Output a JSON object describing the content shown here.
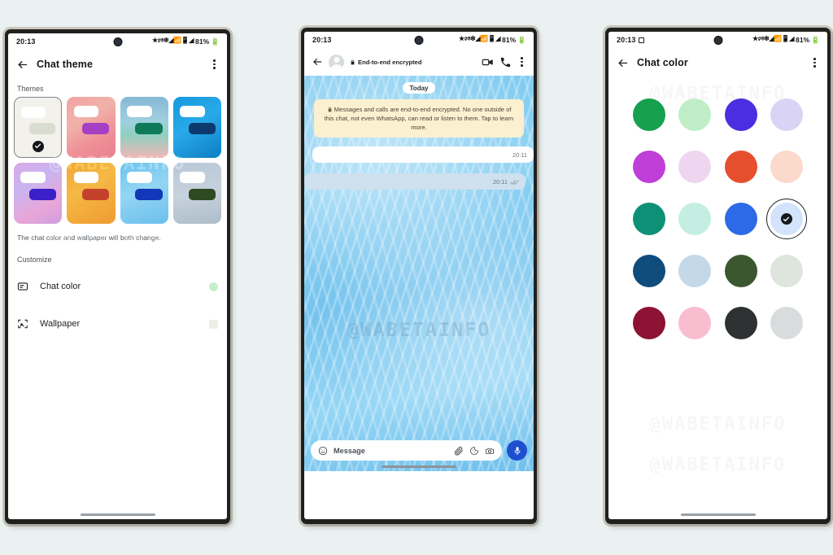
{
  "background_color": "#eaf1f0",
  "watermark": "@WABETAINFO",
  "status_bar": {
    "time": "20:13",
    "battery": "81%",
    "icons": "star, vibrate, cast, signal, network, signal2"
  },
  "phone1": {
    "appbar": {
      "title": "Chat theme",
      "back_icon": "arrow-left-icon",
      "menu_icon": "overflow-menu-icon"
    },
    "themes_label": "Themes",
    "themes": [
      {
        "name": "Default",
        "selected": true,
        "bg": "#f3f1ec",
        "out_bubble": "#d9dcd0"
      },
      {
        "name": "Coral",
        "selected": false,
        "bg": "linear-gradient(150deg,#f2a2a4 0%,#f0b3a8 35%,#ef8e96 70%,#e87f8e 100%)",
        "out_bubble": "#a53fc4"
      },
      {
        "name": "Sky",
        "selected": false,
        "bg": "linear-gradient(180deg,#86b8d6 0%,#9fd0e0 40%,#8fd0c0 62%,#f2b6b6 100%)",
        "out_bubble": "#0f7a58"
      },
      {
        "name": "Azure",
        "selected": false,
        "bg": "linear-gradient(150deg,#1799dd 0%,#29a9e8 45%,#0c7fc4 100%)",
        "out_bubble": "#0c3a6e"
      },
      {
        "name": "Lilac",
        "selected": false,
        "bg": "linear-gradient(150deg,#d9a9e8 0%,#c9b4f0 35%,#e8a6d8 70%,#cf9ee0 100%)",
        "out_bubble": "#3b20c8"
      },
      {
        "name": "Amber",
        "selected": false,
        "bg": "linear-gradient(150deg,#f0a638 0%,#f5b945 40%,#ef9a30 100%)",
        "out_bubble": "#c4422c"
      },
      {
        "name": "Aqua",
        "selected": false,
        "bg": "linear-gradient(160deg,#6cc4ef 0%,#93d5f3 45%,#6bbfec 100%)",
        "out_bubble": "#1038b8"
      },
      {
        "name": "Leaf",
        "selected": false,
        "bg": "linear-gradient(170deg,#b9c8d8 0%,#c6d2dc 50%,#aebdcb 100%)",
        "out_bubble": "#2d4a22"
      }
    ],
    "note": "The chat color and wallpaper will both change.",
    "customize_label": "Customize",
    "rows": [
      {
        "label": "Chat color",
        "icon": "chat-color-icon",
        "swatch": "#c6f0ca",
        "shape": "dot"
      },
      {
        "label": "Wallpaper",
        "icon": "wallpaper-icon",
        "swatch": "#efeee6",
        "shape": "square"
      }
    ]
  },
  "phone2": {
    "appbar": {
      "back_icon": "arrow-left-icon",
      "avatar": "contact-avatar",
      "encrypted_label": "End-to-end encrypted",
      "lock_icon": "lock-icon",
      "video_icon": "video-call-icon",
      "call_icon": "phone-call-icon",
      "menu_icon": "overflow-menu-icon"
    },
    "day_pill": "Today",
    "encryption_notice": "Messages and calls are end-to-end encrypted. No one outside of this chat, not even WhatsApp, can read or listen to them. Tap to learn more.",
    "messages": [
      {
        "direction": "incoming",
        "time": "20:11",
        "ticks": ""
      },
      {
        "direction": "outgoing",
        "time": "20:11",
        "ticks": "read-receipt-double-check"
      }
    ],
    "input": {
      "placeholder": "Message",
      "emoji_icon": "emoji-icon",
      "attach_icon": "attachment-icon",
      "sticker_icon": "sticker-icon",
      "camera_icon": "camera-icon",
      "mic_icon": "microphone-icon",
      "mic_button_color": "#1f4fd0"
    }
  },
  "phone3": {
    "appbar": {
      "title": "Chat color",
      "back_icon": "arrow-left-icon",
      "menu_icon": "overflow-menu-icon"
    },
    "colors": [
      {
        "name": "green",
        "hex": "#17a04e",
        "selected": false
      },
      {
        "name": "light-green",
        "hex": "#bfeec6",
        "selected": false
      },
      {
        "name": "indigo",
        "hex": "#4b2ee0",
        "selected": false
      },
      {
        "name": "pale-lilac",
        "hex": "#d9d4f5",
        "selected": false
      },
      {
        "name": "purple",
        "hex": "#bf3fd8",
        "selected": false
      },
      {
        "name": "pale-pink",
        "hex": "#eed6f0",
        "selected": false
      },
      {
        "name": "orange-red",
        "hex": "#e64f2e",
        "selected": false
      },
      {
        "name": "pale-peach",
        "hex": "#fbd9cb",
        "selected": false
      },
      {
        "name": "teal",
        "hex": "#0d9176",
        "selected": false
      },
      {
        "name": "pale-mint",
        "hex": "#c4eee2",
        "selected": false
      },
      {
        "name": "blue",
        "hex": "#2d6ae8",
        "selected": false
      },
      {
        "name": "pale-blue",
        "hex": "#d2e3fb",
        "selected": true
      },
      {
        "name": "navy",
        "hex": "#0f4c7c",
        "selected": false
      },
      {
        "name": "powder-blue",
        "hex": "#c5d8e8",
        "selected": false
      },
      {
        "name": "dark-olive",
        "hex": "#3b5730",
        "selected": false
      },
      {
        "name": "pale-sage",
        "hex": "#dde5dc",
        "selected": false
      },
      {
        "name": "maroon",
        "hex": "#8c1333",
        "selected": false
      },
      {
        "name": "pink",
        "hex": "#f9bdd0",
        "selected": false
      },
      {
        "name": "charcoal",
        "hex": "#2f3233",
        "selected": false
      },
      {
        "name": "light-grey",
        "hex": "#d9dcdd",
        "selected": false
      }
    ]
  }
}
